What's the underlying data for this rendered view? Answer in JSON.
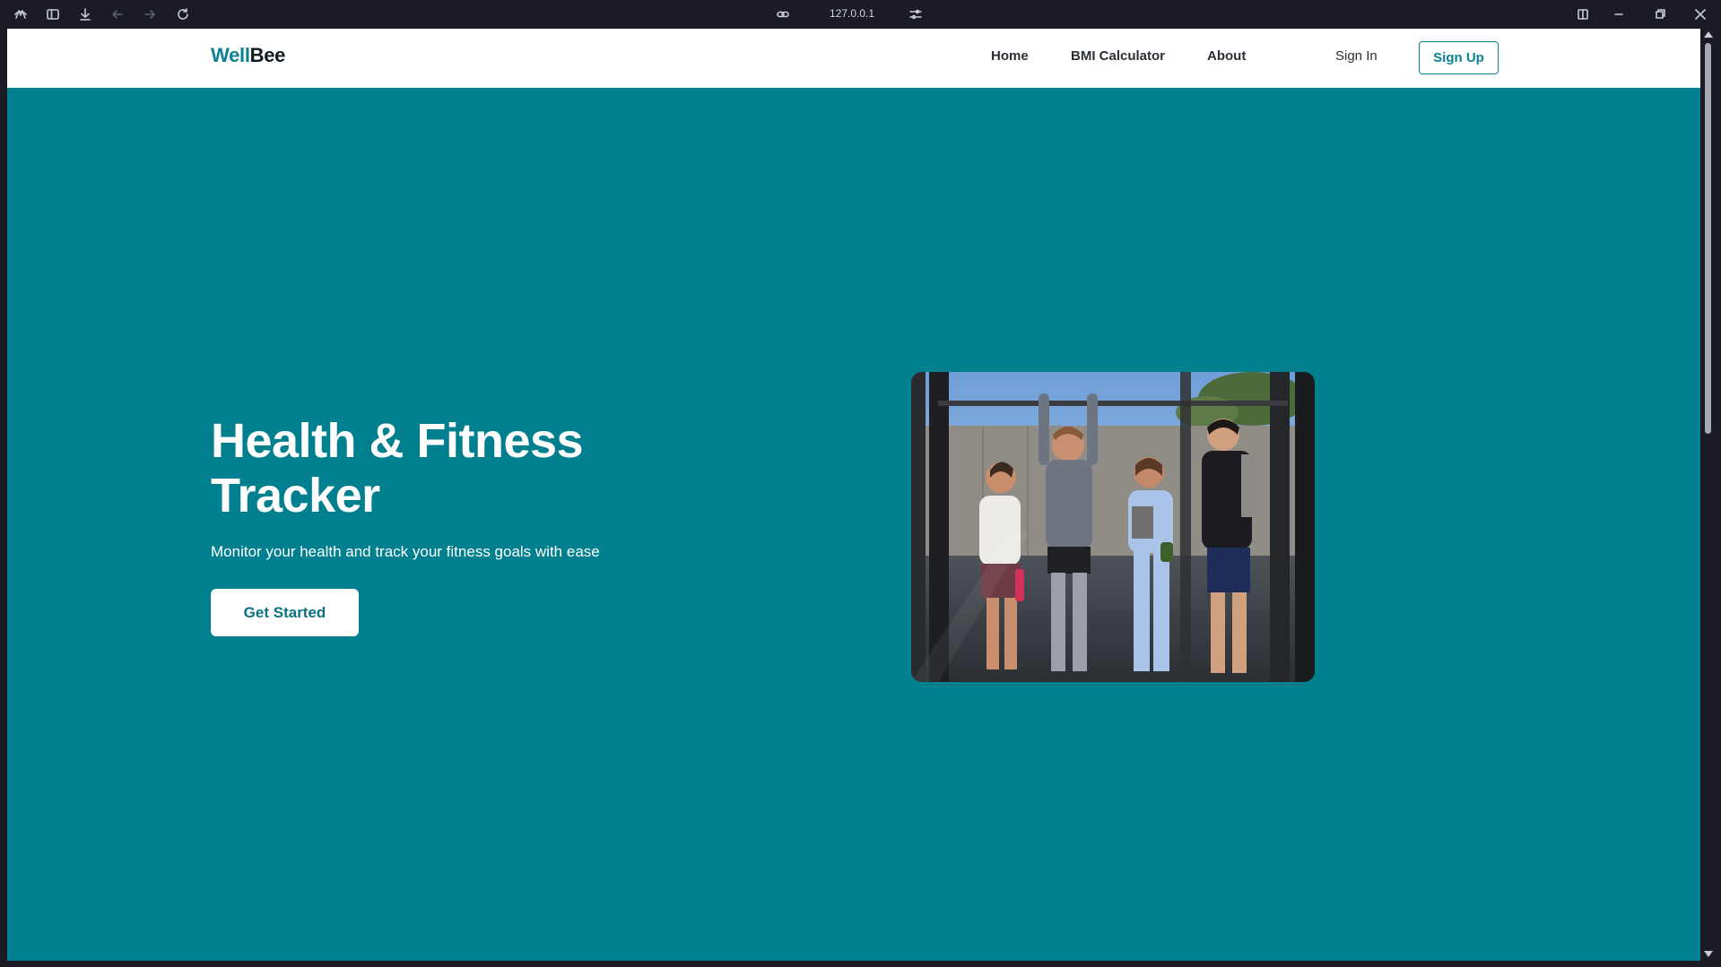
{
  "browser": {
    "url": "127.0.0.1",
    "icons": [
      "app-logo-icon",
      "sidebar-toggle-icon",
      "download-icon",
      "back-icon",
      "forward-icon",
      "reload-icon",
      "link-icon",
      "site-settings-icon",
      "split-view-icon",
      "minimize-icon",
      "maximize-icon",
      "close-icon"
    ]
  },
  "navbar": {
    "logo_part1": "Well",
    "logo_part2": "Bee",
    "links": {
      "home": "Home",
      "bmi": "BMI Calculator",
      "about": "About"
    },
    "sign_in": "Sign In",
    "sign_up": "Sign Up"
  },
  "hero": {
    "title_line1": "Health & Fitness",
    "title_line2": "Tracker",
    "subtitle": "Monitor your health and track your fitness goals with ease",
    "cta": "Get Started"
  },
  "colors": {
    "primary": "#00808f",
    "accent": "#0a8294",
    "chrome": "#1b1b26"
  }
}
